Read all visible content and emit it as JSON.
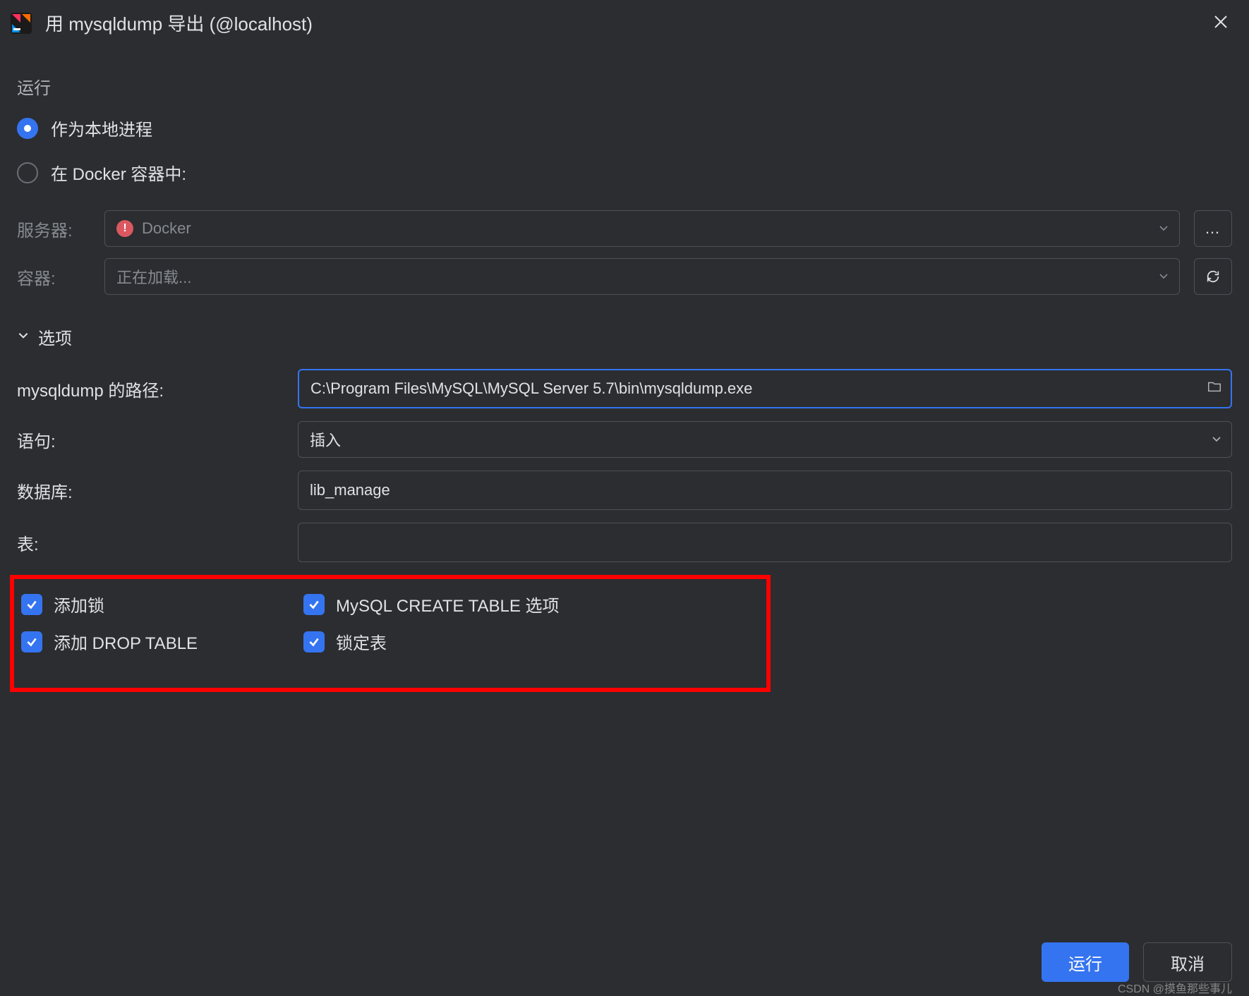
{
  "title": "用 mysqldump 导出 (@localhost)",
  "sections": {
    "run_label": "运行",
    "radio_local": "作为本地进程",
    "radio_docker": "在 Docker 容器中:",
    "server_label": "服务器:",
    "server_value": "Docker",
    "container_label": "容器:",
    "container_value": "正在加载...",
    "options_label": "选项",
    "path_label": "mysqldump 的路径:",
    "path_value": "C:\\Program Files\\MySQL\\MySQL Server 5.7\\bin\\mysqldump.exe",
    "statement_label": "语句:",
    "statement_value": "插入",
    "database_label": "数据库:",
    "database_value": "lib_manage",
    "tables_label": "表:",
    "tables_value": "",
    "cb_add_lock": "添加锁",
    "cb_create_table": "MySQL CREATE TABLE 选项",
    "cb_drop_table": "添加 DROP TABLE",
    "cb_lock_tables": "锁定表"
  },
  "buttons": {
    "run": "运行",
    "cancel": "取消"
  },
  "watermark": "CSDN @摸鱼那些事儿",
  "icon_btn_more": "…"
}
